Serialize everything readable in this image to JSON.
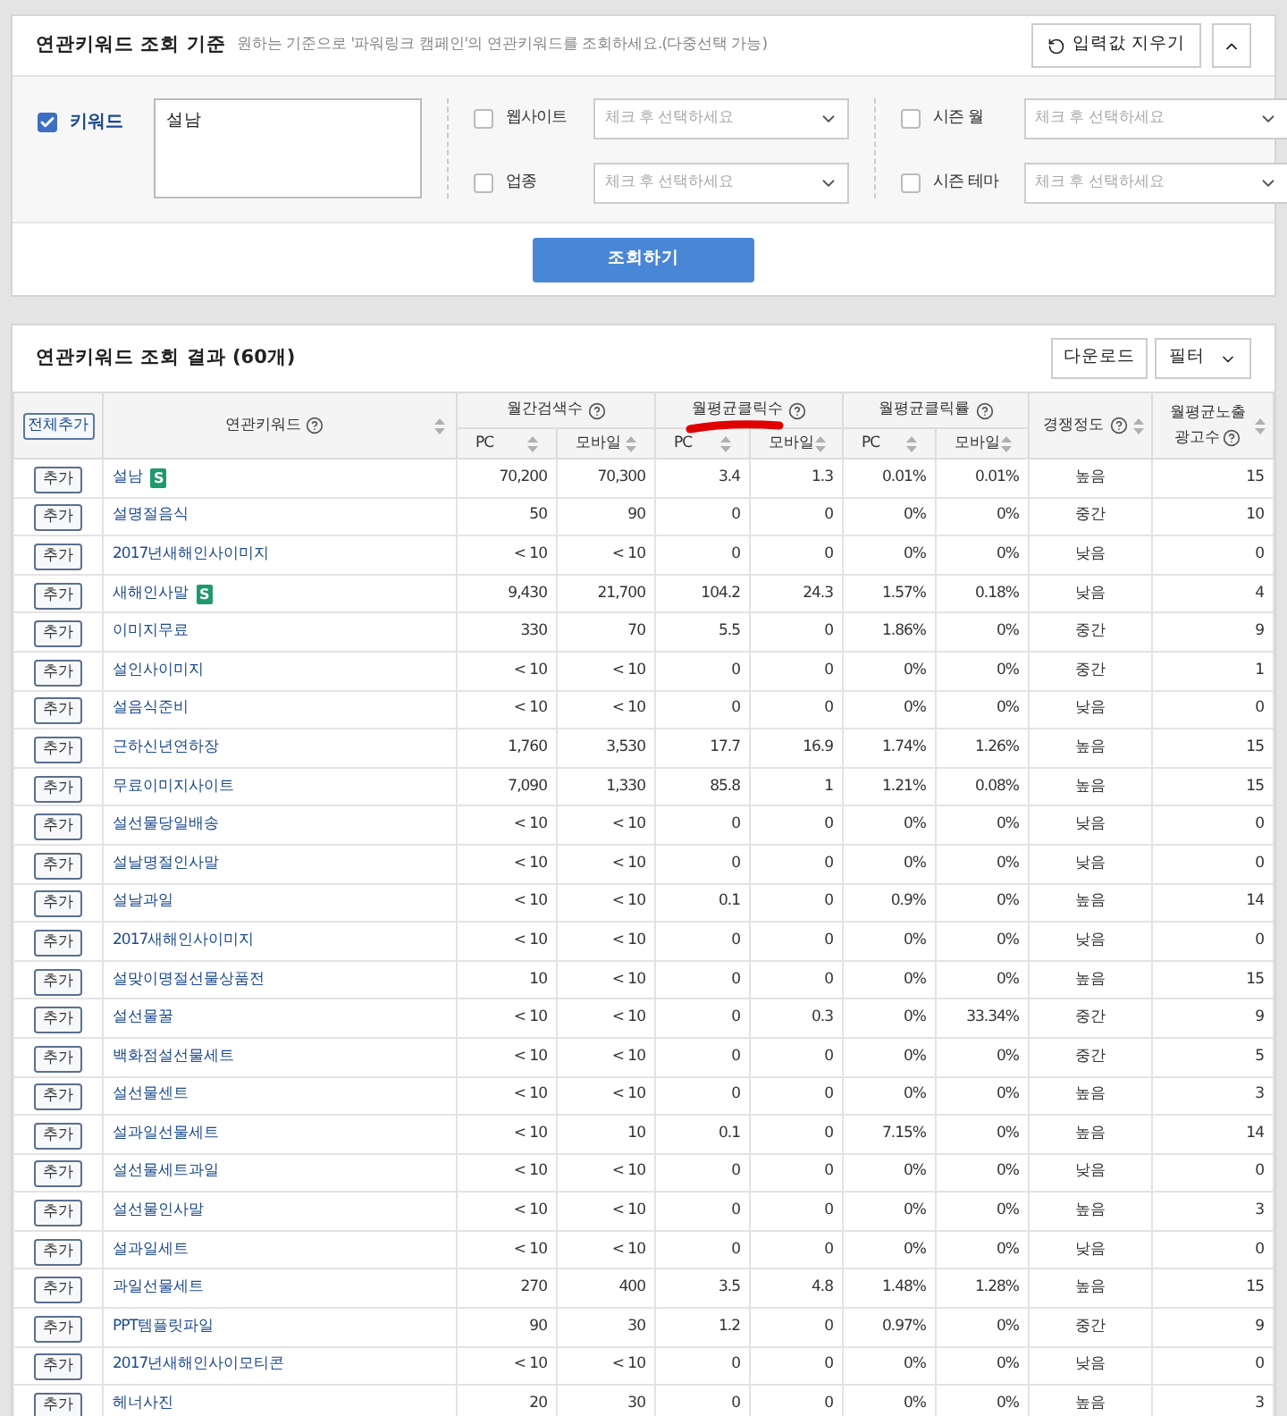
{
  "criteria": {
    "title": "연관키워드 조회 기준",
    "hint": "원하는 기준으로 '파워링크 캠페인'의 연관키워드를 조회하세요.(다중선택 가능)",
    "reset_button": "입력값 지우기",
    "keyword": {
      "label": "키워드",
      "checked": true,
      "value": "설남"
    },
    "filters": [
      {
        "label": "웹사이트",
        "checked": false,
        "placeholder": "체크 후 선택하세요"
      },
      {
        "label": "업종",
        "checked": false,
        "placeholder": "체크 후 선택하세요"
      },
      {
        "label": "시즌 월",
        "checked": false,
        "placeholder": "체크 후 선택하세요"
      },
      {
        "label": "시즌 테마",
        "checked": false,
        "placeholder": "체크 후 선택하세요"
      }
    ],
    "search_button": "조회하기"
  },
  "results": {
    "title": "연관키워드 조회 결과 (60개)",
    "download_button": "다운로드",
    "filter_button": "필터",
    "add_all_button": "전체추가",
    "keyword_column": "연관키워드",
    "groups": [
      "월간검색수",
      "월평균클릭수",
      "월평균클릭률"
    ],
    "subcolumns": [
      "PC",
      "모바일",
      "PC",
      "모바일",
      "PC",
      "모바일"
    ],
    "competition_column": "경쟁정도",
    "ads_column": [
      "월평균노출",
      "광고수"
    ],
    "rows": [
      {
        "add": "추가",
        "keyword": "설남",
        "badge": "S",
        "cells": [
          "70,200",
          "70,300",
          "3.4",
          "1.3",
          "0.01%",
          "0.01%",
          "높음",
          "15"
        ]
      },
      {
        "add": "추가",
        "keyword": "설명절음식",
        "cells": [
          "50",
          "90",
          "0",
          "0",
          "0%",
          "0%",
          "중간",
          "10"
        ]
      },
      {
        "add": "추가",
        "keyword": "2017년새해인사이미지",
        "cells": [
          "< 10",
          "< 10",
          "0",
          "0",
          "0%",
          "0%",
          "낮음",
          "0"
        ]
      },
      {
        "add": "추가",
        "keyword": "새해인사말",
        "badge": "S",
        "cells": [
          "9,430",
          "21,700",
          "104.2",
          "24.3",
          "1.57%",
          "0.18%",
          "낮음",
          "4"
        ]
      },
      {
        "add": "추가",
        "keyword": "이미지무료",
        "cells": [
          "330",
          "70",
          "5.5",
          "0",
          "1.86%",
          "0%",
          "중간",
          "9"
        ]
      },
      {
        "add": "추가",
        "keyword": "설인사이미지",
        "cells": [
          "< 10",
          "< 10",
          "0",
          "0",
          "0%",
          "0%",
          "중간",
          "1"
        ]
      },
      {
        "add": "추가",
        "keyword": "설음식준비",
        "cells": [
          "< 10",
          "< 10",
          "0",
          "0",
          "0%",
          "0%",
          "낮음",
          "0"
        ]
      },
      {
        "add": "추가",
        "keyword": "근하신년연하장",
        "cells": [
          "1,760",
          "3,530",
          "17.7",
          "16.9",
          "1.74%",
          "1.26%",
          "높음",
          "15"
        ]
      },
      {
        "add": "추가",
        "keyword": "무료이미지사이트",
        "cells": [
          "7,090",
          "1,330",
          "85.8",
          "1",
          "1.21%",
          "0.08%",
          "높음",
          "15"
        ]
      },
      {
        "add": "추가",
        "keyword": "설선물당일배송",
        "cells": [
          "< 10",
          "< 10",
          "0",
          "0",
          "0%",
          "0%",
          "낮음",
          "0"
        ]
      },
      {
        "add": "추가",
        "keyword": "설날명절인사말",
        "cells": [
          "< 10",
          "< 10",
          "0",
          "0",
          "0%",
          "0%",
          "낮음",
          "0"
        ]
      },
      {
        "add": "추가",
        "keyword": "설날과일",
        "cells": [
          "< 10",
          "< 10",
          "0.1",
          "0",
          "0.9%",
          "0%",
          "높음",
          "14"
        ]
      },
      {
        "add": "추가",
        "keyword": "2017새해인사이미지",
        "cells": [
          "< 10",
          "< 10",
          "0",
          "0",
          "0%",
          "0%",
          "낮음",
          "0"
        ]
      },
      {
        "add": "추가",
        "keyword": "설맞이명절선물상품전",
        "cells": [
          "10",
          "< 10",
          "0",
          "0",
          "0%",
          "0%",
          "높음",
          "15"
        ]
      },
      {
        "add": "추가",
        "keyword": "설선물꿀",
        "cells": [
          "< 10",
          "< 10",
          "0",
          "0.3",
          "0%",
          "33.34%",
          "중간",
          "9"
        ]
      },
      {
        "add": "추가",
        "keyword": "백화점설선물세트",
        "cells": [
          "< 10",
          "< 10",
          "0",
          "0",
          "0%",
          "0%",
          "중간",
          "5"
        ]
      },
      {
        "add": "추가",
        "keyword": "설선물센트",
        "cells": [
          "< 10",
          "< 10",
          "0",
          "0",
          "0%",
          "0%",
          "높음",
          "3"
        ]
      },
      {
        "add": "추가",
        "keyword": "설과일선물세트",
        "cells": [
          "< 10",
          "10",
          "0.1",
          "0",
          "7.15%",
          "0%",
          "높음",
          "14"
        ]
      },
      {
        "add": "추가",
        "keyword": "설선물세트과일",
        "cells": [
          "< 10",
          "< 10",
          "0",
          "0",
          "0%",
          "0%",
          "낮음",
          "0"
        ]
      },
      {
        "add": "추가",
        "keyword": "설선물인사말",
        "cells": [
          "< 10",
          "< 10",
          "0",
          "0",
          "0%",
          "0%",
          "높음",
          "3"
        ]
      },
      {
        "add": "추가",
        "keyword": "설과일세트",
        "cells": [
          "< 10",
          "< 10",
          "0",
          "0",
          "0%",
          "0%",
          "낮음",
          "0"
        ]
      },
      {
        "add": "추가",
        "keyword": "과일선물세트",
        "cells": [
          "270",
          "400",
          "3.5",
          "4.8",
          "1.48%",
          "1.28%",
          "높음",
          "15"
        ]
      },
      {
        "add": "추가",
        "keyword": "PPT템플릿파일",
        "cells": [
          "90",
          "30",
          "1.2",
          "0",
          "0.97%",
          "0%",
          "중간",
          "9"
        ]
      },
      {
        "add": "추가",
        "keyword": "2017년새해인사이모티콘",
        "cells": [
          "< 10",
          "< 10",
          "0",
          "0",
          "0%",
          "0%",
          "낮음",
          "0"
        ]
      },
      {
        "add": "추가",
        "keyword": "헤너사진",
        "cells": [
          "20",
          "30",
          "0",
          "0",
          "0%",
          "0%",
          "높음",
          "3"
        ]
      }
    ]
  }
}
